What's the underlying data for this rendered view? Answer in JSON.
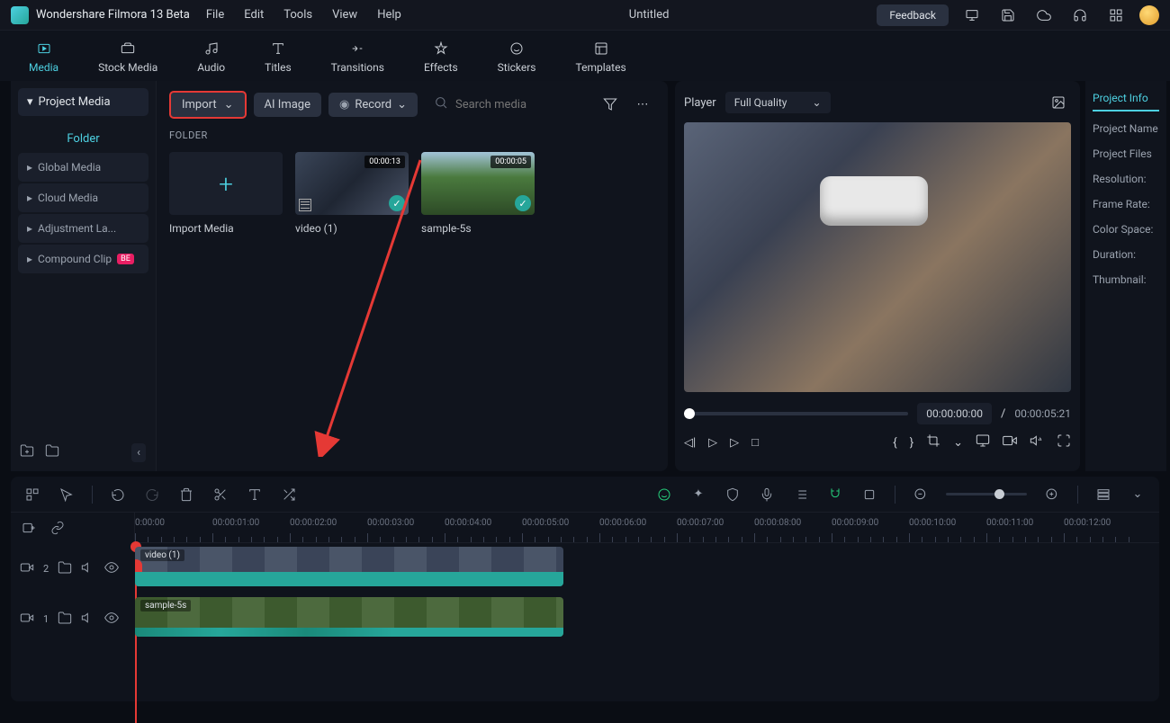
{
  "app": {
    "title": "Wondershare Filmora 13 Beta",
    "doc": "Untitled"
  },
  "menu": [
    "File",
    "Edit",
    "Tools",
    "View",
    "Help"
  ],
  "feedback": "Feedback",
  "tabs": [
    {
      "id": "media",
      "label": "Media",
      "active": true
    },
    {
      "id": "stock",
      "label": "Stock Media"
    },
    {
      "id": "audio",
      "label": "Audio"
    },
    {
      "id": "titles",
      "label": "Titles"
    },
    {
      "id": "transitions",
      "label": "Transitions"
    },
    {
      "id": "effects",
      "label": "Effects"
    },
    {
      "id": "stickers",
      "label": "Stickers"
    },
    {
      "id": "templates",
      "label": "Templates"
    }
  ],
  "sidebar": {
    "header": "Project Media",
    "folder": "Folder",
    "items": [
      "Global Media",
      "Cloud Media",
      "Adjustment La...",
      "Compound Clip"
    ]
  },
  "toolbar": {
    "import": "Import",
    "ai_image": "AI Image",
    "record": "Record",
    "search_ph": "Search media"
  },
  "folder_label": "FOLDER",
  "media": [
    {
      "label": "Import Media",
      "type": "plus"
    },
    {
      "label": "video (1)",
      "type": "vr",
      "duration": "00:00:13"
    },
    {
      "label": "sample-5s",
      "type": "trees",
      "duration": "00:00:05"
    }
  ],
  "preview": {
    "player": "Player",
    "quality": "Full Quality",
    "time_current": "00:00:00:00",
    "time_total": "00:00:05:21"
  },
  "info": {
    "tab": "Project Info",
    "rows": [
      "Project Name",
      "Project Files",
      "Resolution:",
      "Frame Rate:",
      "Color Space:",
      "Duration:",
      "Thumbnail:"
    ]
  },
  "timeline": {
    "tracks": [
      {
        "id": 2,
        "clip": "video (1)"
      },
      {
        "id": 1,
        "clip": "sample-5s"
      }
    ],
    "ruler_marks": [
      "0:00:00",
      "00:00:01:00",
      "00:00:02:00",
      "00:00:03:00",
      "00:00:04:00",
      "00:00:05:00",
      "00:00:06:00",
      "00:00:07:00",
      "00:00:08:00",
      "00:00:09:00",
      "00:00:10:00",
      "00:00:11:00",
      "00:00:12:00"
    ]
  }
}
